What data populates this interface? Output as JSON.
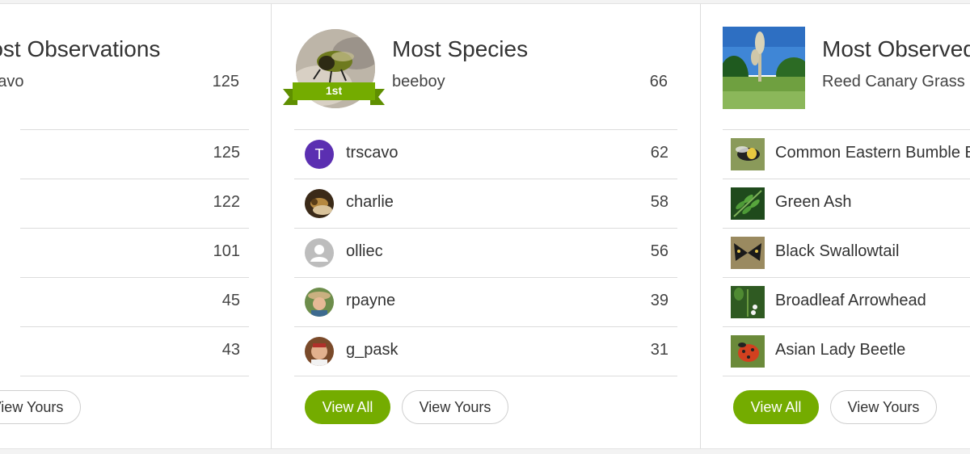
{
  "colors": {
    "accent": "#74ac00",
    "ribbon": "#74ac00",
    "avatar_t": "#5b2fb1"
  },
  "col1": {
    "title": "Most Observations",
    "top_user": "trscavo",
    "top_count": "125",
    "rows": [
      {
        "count": "125"
      },
      {
        "count": "122"
      },
      {
        "count": "101"
      },
      {
        "count": "45"
      },
      {
        "count": "43"
      }
    ],
    "view_yours": "View Yours"
  },
  "col2": {
    "title": "Most Species",
    "ribbon": "1st",
    "top_user": "beeboy",
    "top_count": "66",
    "rows": [
      {
        "name": "trscavo",
        "count": "62",
        "initial": "T"
      },
      {
        "name": "charlie",
        "count": "58"
      },
      {
        "name": "olliec",
        "count": "56"
      },
      {
        "name": "rpayne",
        "count": "39"
      },
      {
        "name": "g_pask",
        "count": "31"
      }
    ],
    "view_all": "View All",
    "view_yours": "View Yours"
  },
  "col3": {
    "title": "Most Observed Species",
    "top_species": "Reed Canary Grass",
    "rows": [
      {
        "name": "Common Eastern Bumble Bee"
      },
      {
        "name": "Green Ash"
      },
      {
        "name": "Black Swallowtail"
      },
      {
        "name": "Broadleaf Arrowhead"
      },
      {
        "name": "Asian Lady Beetle"
      }
    ],
    "view_all": "View All",
    "view_yours": "View Yours"
  }
}
